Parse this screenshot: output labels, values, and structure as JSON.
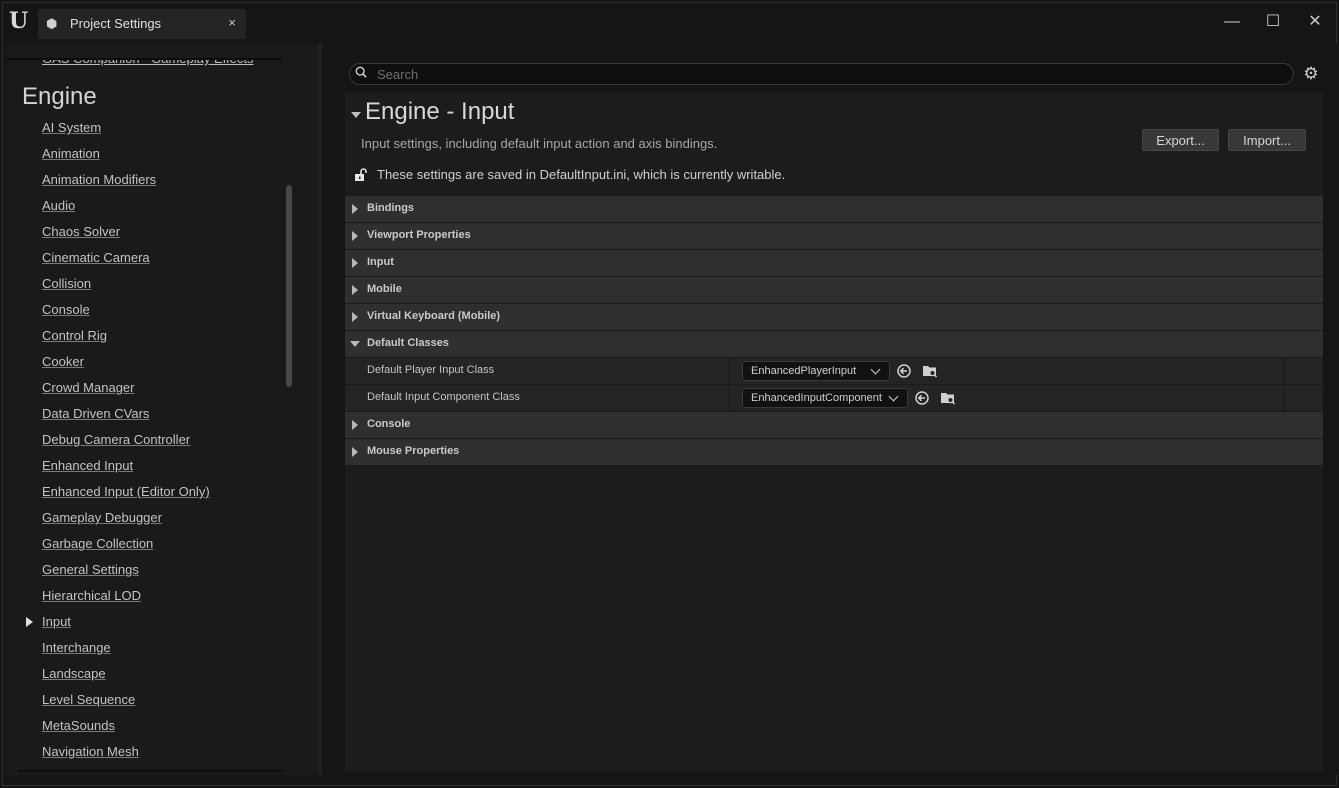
{
  "window": {
    "tab_title": "Project Settings",
    "tab_close": "×",
    "minimize": "—",
    "maximize": "☐",
    "close": "✕"
  },
  "nav": {
    "partial_item": "GAS Companion - Gameplay Effects",
    "heading": "Engine",
    "items": [
      {
        "label": "AI System"
      },
      {
        "label": "Animation"
      },
      {
        "label": "Animation Modifiers"
      },
      {
        "label": "Audio"
      },
      {
        "label": "Chaos Solver"
      },
      {
        "label": "Cinematic Camera"
      },
      {
        "label": "Collision"
      },
      {
        "label": "Console"
      },
      {
        "label": "Control Rig"
      },
      {
        "label": "Cooker"
      },
      {
        "label": "Crowd Manager"
      },
      {
        "label": "Data Driven CVars"
      },
      {
        "label": "Debug Camera Controller"
      },
      {
        "label": "Enhanced Input"
      },
      {
        "label": "Enhanced Input (Editor Only)"
      },
      {
        "label": "Gameplay Debugger"
      },
      {
        "label": "Garbage Collection"
      },
      {
        "label": "General Settings"
      },
      {
        "label": "Hierarchical LOD"
      },
      {
        "label": "Input"
      },
      {
        "label": "Interchange"
      },
      {
        "label": "Landscape"
      },
      {
        "label": "Level Sequence"
      },
      {
        "label": "MetaSounds"
      },
      {
        "label": "Navigation Mesh"
      }
    ],
    "selected_index": 19
  },
  "search": {
    "placeholder": "Search",
    "value": ""
  },
  "section": {
    "title": "Engine - Input",
    "description": "Input settings, including default input action and axis bindings.",
    "export_label": "Export...",
    "import_label": "Import...",
    "saved_note": "These settings are saved in DefaultInput.ini, which is currently writable."
  },
  "categories": {
    "bindings": "Bindings",
    "viewport": "Viewport Properties",
    "input": "Input",
    "mobile": "Mobile",
    "virtual_keyboard": "Virtual Keyboard (Mobile)",
    "default_classes": "Default Classes",
    "console": "Console",
    "mouse": "Mouse Properties"
  },
  "default_classes": {
    "player_input": {
      "name": "Default Player Input Class",
      "value": "EnhancedPlayerInput"
    },
    "input_component": {
      "name": "Default Input Component Class",
      "value": "EnhancedInputComponent"
    }
  },
  "icons": {
    "app_logo": "unreal-logo-icon",
    "tab": "settings-cube-icon",
    "gear": "gear-icon",
    "lock": "unlock-icon",
    "reset": "reset-arrow-icon",
    "browse": "browse-folder-icon"
  }
}
